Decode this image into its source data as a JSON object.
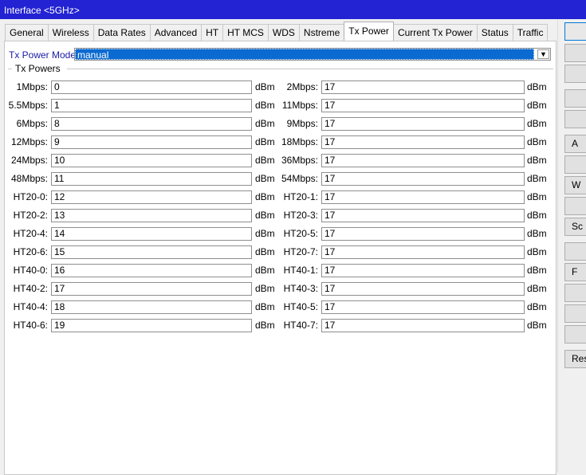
{
  "window": {
    "title": "Interface <5GHz>"
  },
  "tabs": [
    {
      "label": "General",
      "active": false
    },
    {
      "label": "Wireless",
      "active": false
    },
    {
      "label": "Data Rates",
      "active": false
    },
    {
      "label": "Advanced",
      "active": false
    },
    {
      "label": "HT",
      "active": false
    },
    {
      "label": "HT MCS",
      "active": false
    },
    {
      "label": "WDS",
      "active": false
    },
    {
      "label": "Nstreme",
      "active": false
    },
    {
      "label": "Tx Power",
      "active": true
    },
    {
      "label": "Current Tx Power",
      "active": false
    },
    {
      "label": "Status",
      "active": false
    },
    {
      "label": "Traffic",
      "active": false
    }
  ],
  "mode": {
    "label": "Tx Power Mode:",
    "value": "manual",
    "arrow": "▼"
  },
  "group": {
    "title": "Tx Powers"
  },
  "unit": "dBm",
  "rows": [
    {
      "left_label": "1Mbps:",
      "left_value": "0",
      "right_label": "2Mbps:",
      "right_value": "17"
    },
    {
      "left_label": "5.5Mbps:",
      "left_value": "1",
      "right_label": "11Mbps:",
      "right_value": "17"
    },
    {
      "left_label": "6Mbps:",
      "left_value": "8",
      "right_label": "9Mbps:",
      "right_value": "17"
    },
    {
      "left_label": "12Mbps:",
      "left_value": "9",
      "right_label": "18Mbps:",
      "right_value": "17"
    },
    {
      "left_label": "24Mbps:",
      "left_value": "10",
      "right_label": "36Mbps:",
      "right_value": "17"
    },
    {
      "left_label": "48Mbps:",
      "left_value": "11",
      "right_label": "54Mbps:",
      "right_value": "17"
    },
    {
      "left_label": "HT20-0:",
      "left_value": "12",
      "right_label": "HT20-1:",
      "right_value": "17"
    },
    {
      "left_label": "HT20-2:",
      "left_value": "13",
      "right_label": "HT20-3:",
      "right_value": "17"
    },
    {
      "left_label": "HT20-4:",
      "left_value": "14",
      "right_label": "HT20-5:",
      "right_value": "17"
    },
    {
      "left_label": "HT20-6:",
      "left_value": "15",
      "right_label": "HT20-7:",
      "right_value": "17"
    },
    {
      "left_label": "HT40-0:",
      "left_value": "16",
      "right_label": "HT40-1:",
      "right_value": "17"
    },
    {
      "left_label": "HT40-2:",
      "left_value": "17",
      "right_label": "HT40-3:",
      "right_value": "17"
    },
    {
      "left_label": "HT40-4:",
      "left_value": "18",
      "right_label": "HT40-5:",
      "right_value": "17"
    },
    {
      "left_label": "HT40-6:",
      "left_value": "19",
      "right_label": "HT40-7:",
      "right_value": "17"
    }
  ],
  "side_buttons": [
    "",
    "",
    "",
    "",
    "",
    "A",
    "",
    "W",
    "",
    "Sc",
    "",
    "F",
    "",
    "",
    "",
    "Res"
  ]
}
